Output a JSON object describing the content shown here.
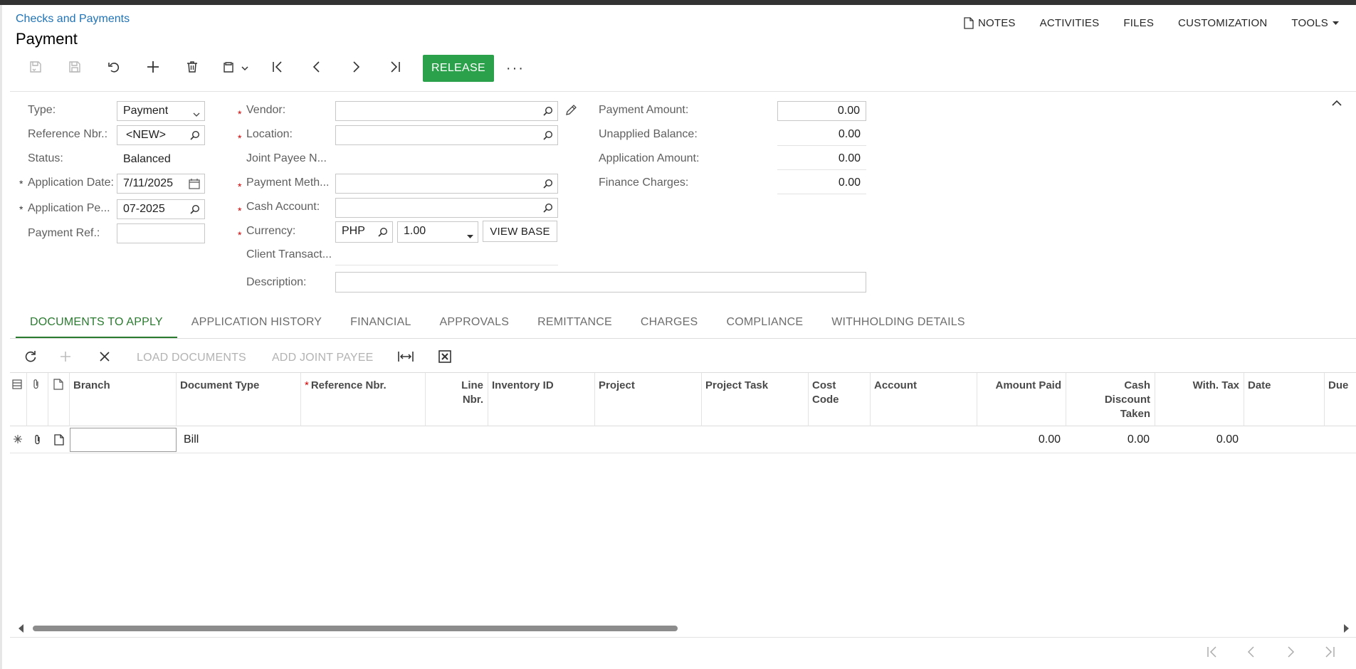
{
  "header": {
    "breadcrumb": "Checks and Payments",
    "title": "Payment",
    "menu": {
      "notes": "NOTES",
      "activities": "ACTIVITIES",
      "files": "FILES",
      "customization": "CUSTOMIZATION",
      "tools": "TOOLS"
    }
  },
  "toolbar": {
    "release_label": "RELEASE",
    "more_label": "···"
  },
  "form": {
    "type_label": "Type:",
    "type_value": "Payment",
    "refnbr_label": "Reference Nbr.:",
    "refnbr_value": "<NEW>",
    "status_label": "Status:",
    "status_value": "Balanced",
    "appdate_label": "Application Date:",
    "appdate_value": "7/11/2025",
    "appperiod_label": "Application Pe...",
    "appperiod_value": "07-2025",
    "payref_label": "Payment Ref.:",
    "payref_value": "",
    "vendor_label": "Vendor:",
    "vendor_value": "",
    "location_label": "Location:",
    "location_value": "",
    "jointpayee_label": "Joint Payee N...",
    "paymethod_label": "Payment Meth...",
    "paymethod_value": "",
    "cashaccount_label": "Cash Account:",
    "cashaccount_value": "",
    "currency_label": "Currency:",
    "currency_value": "PHP",
    "rate_value": "1.00",
    "view_base_label": "VIEW BASE",
    "clienttrans_label": "Client Transact...",
    "description_label": "Description:",
    "description_value": "",
    "payment_amount_label": "Payment Amount:",
    "payment_amount_value": "0.00",
    "unapplied_label": "Unapplied Balance:",
    "unapplied_value": "0.00",
    "application_amount_label": "Application Amount:",
    "application_amount_value": "0.00",
    "finance_charges_label": "Finance Charges:",
    "finance_charges_value": "0.00"
  },
  "tabs": [
    {
      "label": "DOCUMENTS TO APPLY"
    },
    {
      "label": "APPLICATION HISTORY"
    },
    {
      "label": "FINANCIAL"
    },
    {
      "label": "APPROVALS"
    },
    {
      "label": "REMITTANCE"
    },
    {
      "label": "CHARGES"
    },
    {
      "label": "COMPLIANCE"
    },
    {
      "label": "WITHHOLDING DETAILS"
    }
  ],
  "grid_toolbar": {
    "load_documents": "LOAD DOCUMENTS",
    "add_joint_payee": "ADD JOINT PAYEE"
  },
  "grid": {
    "columns": {
      "branch": "Branch",
      "document_type": "Document Type",
      "reference_nbr": "Reference Nbr.",
      "line_nbr": "Line Nbr.",
      "inventory_id": "Inventory ID",
      "project": "Project",
      "project_task": "Project Task",
      "cost_code": "Cost Code",
      "account": "Account",
      "amount_paid": "Amount Paid",
      "cash_discount_taken": "Cash Discount Taken",
      "with_tax": "With. Tax",
      "date": "Date",
      "due": "Due"
    },
    "rows": [
      {
        "branch": "",
        "document_type": "Bill",
        "amount_paid": "0.00",
        "cash_discount_taken": "0.00",
        "with_tax": "0.00"
      }
    ]
  }
}
